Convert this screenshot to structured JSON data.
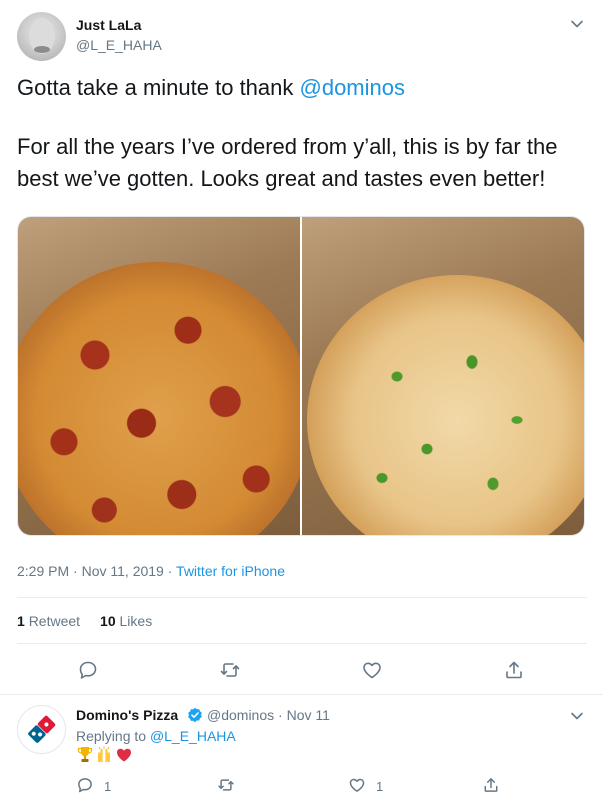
{
  "tweet": {
    "author": {
      "name": "Just LaLa",
      "handle": "@L_E_HAHA"
    },
    "text": {
      "line1_prefix": "Gotta take a minute to thank ",
      "mention": "@dominos",
      "line2": "For all the years I’ve ordered from y’all, this is by far the",
      "line3": "best we’ve gotten. Looks great and tastes even better!"
    },
    "media": [
      {
        "description": "pepperoni pizza"
      },
      {
        "description": "green pepper and onion pizza"
      }
    ],
    "meta": {
      "time": "2:29 PM",
      "separator": " · ",
      "date": "Nov 11, 2019",
      "source": "Twitter for iPhone"
    },
    "stats": {
      "retweets": "1",
      "retweets_label": "Retweet",
      "likes": "10",
      "likes_label": "Likes"
    },
    "actions": [
      "reply-icon",
      "retweet-icon",
      "like-icon",
      "share-icon"
    ]
  },
  "reply": {
    "author": {
      "name": "Domino's Pizza",
      "handle": "@dominos",
      "date": "· Nov 11"
    },
    "replying_prefix": "Replying to ",
    "replying_to": "@L_E_HAHA",
    "emojis": [
      "trophy-emoji",
      "raised-hands-emoji",
      "red-heart-emoji"
    ],
    "counts": {
      "replies": "1",
      "likes": "1"
    }
  },
  "colors": {
    "link": "#1b95e0",
    "secondary": "#657786",
    "primary_text": "#14171a",
    "divider": "#e6ecf0",
    "domino_blue": "#006491",
    "domino_red": "#e31837"
  }
}
